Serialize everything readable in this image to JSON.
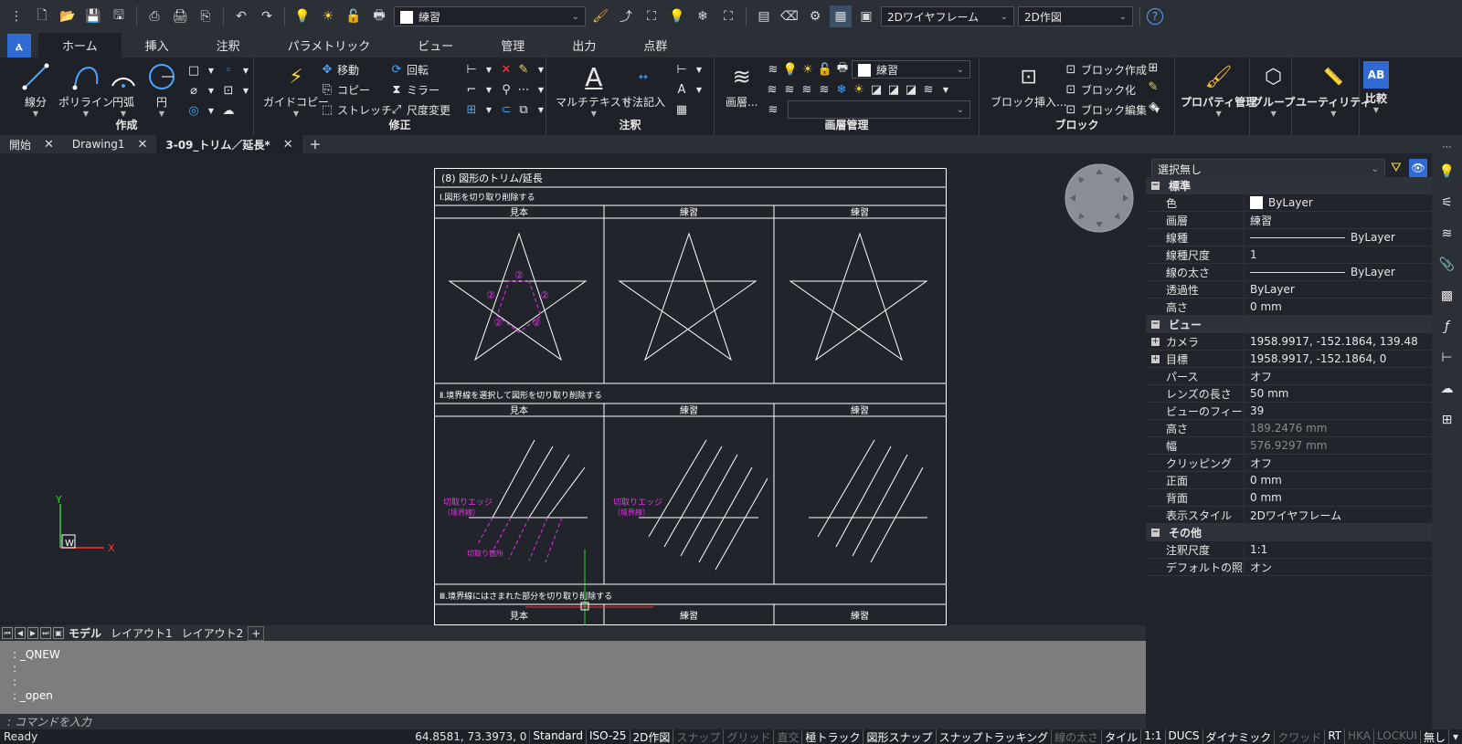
{
  "quick_access": {
    "layer_combo": "練習",
    "visual_style_combo": "2Dワイヤフレーム",
    "workspace_combo": "2D作図"
  },
  "ribbon_tabs": [
    "ホーム",
    "挿入",
    "注釈",
    "パラメトリック",
    "ビュー",
    "管理",
    "出力",
    "点群"
  ],
  "ribbon": {
    "draw": {
      "title": "作成",
      "line": "線分",
      "polyline": "ポリライン",
      "arc": "円弧",
      "circle": "円"
    },
    "modify": {
      "title": "修正",
      "guide_copy": "ガイドコピー",
      "move": "移動",
      "copy": "コピー",
      "stretch": "ストレッチ",
      "rotate": "回転",
      "mirror": "ミラー",
      "scale": "尺度変更"
    },
    "annotation": {
      "title": "注釈",
      "mtext": "マルチテキスト",
      "dimension": "寸法記入"
    },
    "layers": {
      "title": "画層管理",
      "layer_props": "画層...",
      "current_layer": "練習"
    },
    "block": {
      "title": "ブロック",
      "insert": "ブロック挿入...",
      "create": "ブロック作成",
      "blockify": "ブロック化",
      "edit": "ブロック編集"
    },
    "properties": {
      "label": "プロパティ管理"
    },
    "groups": {
      "label": "グループ"
    },
    "utilities": {
      "label": "ユーティリティ"
    },
    "compare": {
      "label": "比較"
    }
  },
  "doc_tabs": [
    "開始",
    "Drawing1",
    "3-09_トリム／延長*"
  ],
  "drawing": {
    "title": "(8) 図形のトリム/延長",
    "section1": "Ⅰ.図形を切り取り削除する",
    "section2": "Ⅱ.境界線を選択して図形を切り取り削除する",
    "section3": "Ⅲ.境界線にはさまれた部分を切り取り削除する",
    "col_sample": "見本",
    "col_practice": "練習",
    "marker": "②",
    "edge_label": "切取りエッジ",
    "edge_sub": "（境界線）",
    "cut_label": "切取り箇所"
  },
  "ucs": {
    "y": "Y",
    "x": "X",
    "w": "W"
  },
  "layout_tabs": [
    "モデル",
    "レイアウト1",
    "レイアウト2"
  ],
  "command": {
    "history": [
      ": _QNEW",
      ":",
      ":",
      ": _open"
    ],
    "prompt": ": コマンドを入力"
  },
  "status": {
    "ready": "Ready",
    "coords": "64.8581, 73.3973, 0",
    "items": [
      {
        "label": "Standard",
        "state": "on"
      },
      {
        "label": "ISO-25",
        "state": "on"
      },
      {
        "label": "2D作図",
        "state": "on"
      },
      {
        "label": "スナップ",
        "state": "off"
      },
      {
        "label": "グリッド",
        "state": "off"
      },
      {
        "label": "直交",
        "state": "off"
      },
      {
        "label": "極トラック",
        "state": "on"
      },
      {
        "label": "図形スナップ",
        "state": "on"
      },
      {
        "label": "スナップトラッキング",
        "state": "on"
      },
      {
        "label": "線の太さ",
        "state": "off"
      },
      {
        "label": "タイル",
        "state": "on"
      },
      {
        "label": "1:1",
        "state": "on"
      },
      {
        "label": "DUCS",
        "state": "on"
      },
      {
        "label": "ダイナミック",
        "state": "on"
      },
      {
        "label": "クワッド",
        "state": "off"
      },
      {
        "label": "RT",
        "state": "on"
      },
      {
        "label": "HKA",
        "state": "off"
      },
      {
        "label": "LOCKUI",
        "state": "off"
      },
      {
        "label": "無し",
        "state": "on"
      }
    ]
  },
  "properties": {
    "selection": "選択無し",
    "cat_general": "標準",
    "cat_view": "ビュー",
    "cat_misc": "その他",
    "general": [
      {
        "k": "色",
        "v": "ByLayer",
        "swatch": true
      },
      {
        "k": "画層",
        "v": "練習"
      },
      {
        "k": "線種",
        "v": "ByLayer",
        "line": true
      },
      {
        "k": "線種尺度",
        "v": "1"
      },
      {
        "k": "線の太さ",
        "v": "ByLayer",
        "line": true
      },
      {
        "k": "透過性",
        "v": "ByLayer"
      },
      {
        "k": "高さ",
        "v": "0 mm"
      }
    ],
    "view": [
      {
        "k": "カメラ",
        "v": "1958.9917, -152.1864, 139.48",
        "expand": true
      },
      {
        "k": "目標",
        "v": "1958.9917, -152.1864, 0",
        "expand": true
      },
      {
        "k": "パース",
        "v": "オフ"
      },
      {
        "k": "レンズの長さ",
        "v": "50 mm"
      },
      {
        "k": "ビューのフィールド",
        "v": "39"
      },
      {
        "k": "高さ",
        "v": "189.2476 mm",
        "gray": true
      },
      {
        "k": "幅",
        "v": "576.9297 mm",
        "gray": true
      },
      {
        "k": "クリッピング",
        "v": "オフ"
      },
      {
        "k": "正面",
        "v": "0 mm"
      },
      {
        "k": "背面",
        "v": "0 mm"
      },
      {
        "k": "表示スタイル",
        "v": "2Dワイヤフレーム"
      }
    ],
    "misc": [
      {
        "k": "注釈尺度",
        "v": "1:1"
      },
      {
        "k": "デフォルトの照明",
        "v": "オン"
      }
    ]
  }
}
